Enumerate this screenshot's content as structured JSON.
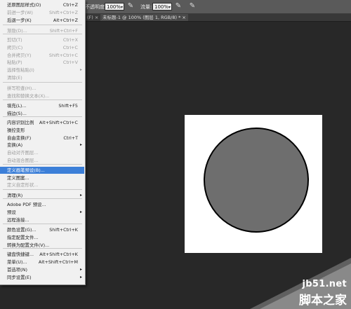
{
  "optionsbar": {
    "opacity_label": "不透明度:",
    "opacity_value": "100%",
    "flow_label": "流量:",
    "flow_value": "100%"
  },
  "tabs": [
    {
      "label": "(F) ×"
    },
    {
      "label": "未标题-1 @ 100% (图层 1, RGB/8) * ×"
    }
  ],
  "menu": {
    "items": [
      {
        "label": "还原图层样式(O)",
        "shortcut": "Ctrl+Z",
        "enabled": true
      },
      {
        "label": "前进一步(W)",
        "shortcut": "Shift+Ctrl+Z",
        "enabled": false
      },
      {
        "label": "后退一步(K)",
        "shortcut": "Alt+Ctrl+Z",
        "enabled": true
      },
      {
        "label": "渐隐(D)...",
        "shortcut": "Shift+Ctrl+F",
        "enabled": false
      },
      {
        "label": "剪切(T)",
        "shortcut": "Ctrl+X",
        "enabled": false
      },
      {
        "label": "拷贝(C)",
        "shortcut": "Ctrl+C",
        "enabled": false
      },
      {
        "label": "合并拷贝(Y)",
        "shortcut": "Shift+Ctrl+C",
        "enabled": false
      },
      {
        "label": "粘贴(P)",
        "shortcut": "Ctrl+V",
        "enabled": false
      },
      {
        "label": "选择性粘贴(I)",
        "shortcut": "",
        "enabled": false,
        "submenu": true
      },
      {
        "label": "清除(E)",
        "shortcut": "",
        "enabled": false
      },
      {
        "label": "拼写检查(H)...",
        "shortcut": "",
        "enabled": false
      },
      {
        "label": "查找和替换文本(X)...",
        "shortcut": "",
        "enabled": false
      },
      {
        "label": "填充(L)...",
        "shortcut": "Shift+F5",
        "enabled": true
      },
      {
        "label": "描边(S)...",
        "shortcut": "",
        "enabled": true
      },
      {
        "label": "内容识别比例",
        "shortcut": "Alt+Shift+Ctrl+C",
        "enabled": true
      },
      {
        "label": "操控变形",
        "shortcut": "",
        "enabled": true
      },
      {
        "label": "自由变换(F)",
        "shortcut": "Ctrl+T",
        "enabled": true
      },
      {
        "label": "变换(A)",
        "shortcut": "",
        "enabled": true,
        "submenu": true
      },
      {
        "label": "自动对齐图层...",
        "shortcut": "",
        "enabled": false
      },
      {
        "label": "自动混合图层...",
        "shortcut": "",
        "enabled": false
      },
      {
        "label": "定义画笔预设(B)...",
        "shortcut": "",
        "enabled": true,
        "highlighted": true
      },
      {
        "label": "定义图案...",
        "shortcut": "",
        "enabled": true
      },
      {
        "label": "定义自定形状...",
        "shortcut": "",
        "enabled": false
      },
      {
        "label": "清理(R)",
        "shortcut": "",
        "enabled": true,
        "submenu": true
      },
      {
        "label": "Adobe PDF 预设...",
        "shortcut": "",
        "enabled": true
      },
      {
        "label": "预设",
        "shortcut": "",
        "enabled": true,
        "submenu": true
      },
      {
        "label": "远程连接...",
        "shortcut": "",
        "enabled": true
      },
      {
        "label": "颜色设置(G)...",
        "shortcut": "Shift+Ctrl+K",
        "enabled": true
      },
      {
        "label": "指定配置文件...",
        "shortcut": "",
        "enabled": true
      },
      {
        "label": "转换为配置文件(V)...",
        "shortcut": "",
        "enabled": true
      },
      {
        "label": "键盘快捷键...",
        "shortcut": "Alt+Shift+Ctrl+K",
        "enabled": true
      },
      {
        "label": "菜单(U)...",
        "shortcut": "Alt+Shift+Ctrl+M",
        "enabled": true
      },
      {
        "label": "首选项(N)",
        "shortcut": "",
        "enabled": true,
        "submenu": true
      },
      {
        "label": "同步设置(E)",
        "shortcut": "",
        "enabled": true,
        "submenu": true
      }
    ]
  },
  "watermark": {
    "url": "jb51.net",
    "name": "脚本之家"
  },
  "colors": {
    "workspace": "#282828",
    "menu_bg": "#f1f1f1",
    "highlight": "#3c7fd8",
    "circle_fill": "#6e6e6e",
    "circle_stroke": "#000000"
  }
}
